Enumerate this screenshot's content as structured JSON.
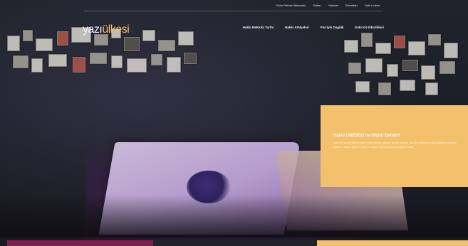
{
  "top_links": [
    "Ekim Refhezi Mekanda",
    "Sultan",
    "Yolanlar",
    "Etkinlikler",
    "Sehi Linken"
  ],
  "logo": {
    "main": "yazı",
    "accent": "ülkesi"
  },
  "nav": [
    "Hakkı Mektubi Tarihi",
    "Hakkı Atölyeleri",
    "Parriyle Dagitik",
    "Eski Kit Etkinlikleri"
  ],
  "info_card": {
    "title": "Hakkı UNESCO ile Hiçbir Deheli?",
    "text": "Yazılı ve sözel kültürün farklı bölümlerinde, yazının tarihini anlatan, yazının gelişimi ve yazılı kültürün evrimini gösteren birçok yapıt ve eser yer alıyor. Yazı tarihi bu yolculukta sizinle."
  },
  "colors": {
    "accent_yellow": "#f3c06b",
    "strip_magenta": "#7e1f4f",
    "background": "#1c1f27"
  }
}
